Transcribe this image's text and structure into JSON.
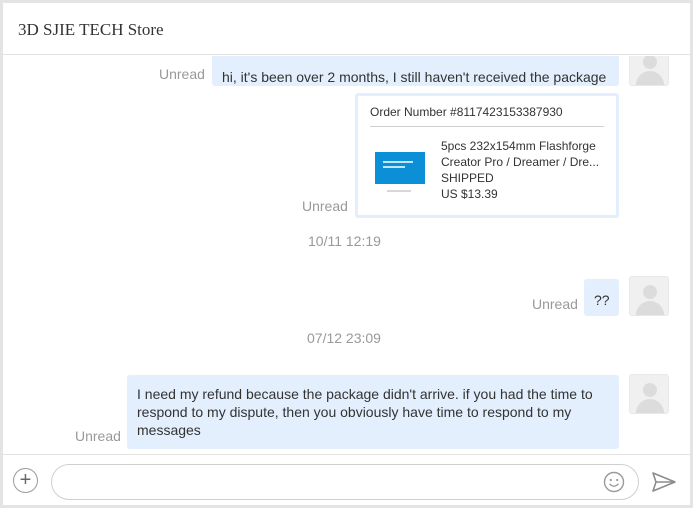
{
  "header": {
    "title": "3D SJIE TECH Store"
  },
  "messages": [
    {
      "text": "hi,  it's been over 2 months, I still haven't received the package",
      "status": "Unread"
    },
    {
      "status": "Unread",
      "order": {
        "number": "Order Number #8117423153387930",
        "product_line1": "5pcs 232x154mm Flashforge",
        "product_line2": "Creator Pro / Dreamer / Dre...",
        "shipping_status": "SHIPPED",
        "price": "US $13.39"
      }
    },
    {
      "timestamp": "10/11 12:19"
    },
    {
      "text": "??",
      "status": "Unread"
    },
    {
      "timestamp": "07/12 23:09"
    },
    {
      "text_lines": [
        "I need my refund because the package didn't arrive. if you had the time to",
        "respond to my dispute,  then you obviously have time to respond to my",
        "messages"
      ],
      "status": "Unread"
    }
  ],
  "composer": {
    "placeholder": "",
    "value": ""
  },
  "icons": {
    "add": "plus-circle-icon",
    "emoji": "smiley-icon",
    "send": "send-arrow-icon",
    "avatar": "user-avatar-icon"
  },
  "colors": {
    "bubble": "#e3effd",
    "product_thumb": "#0b8fd6"
  }
}
